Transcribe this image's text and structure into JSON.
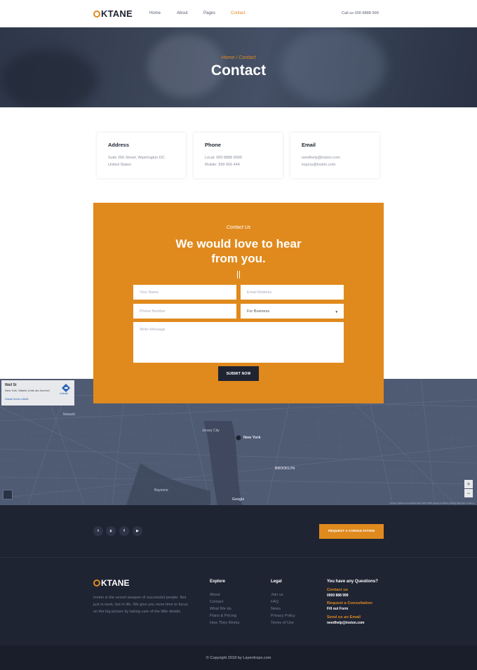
{
  "header": {
    "logo_text": "KTANE",
    "nav": [
      "Home",
      "About",
      "Pages",
      "Contact"
    ],
    "active_nav": "Contact",
    "call_us": "Call us 000 8888 999"
  },
  "hero": {
    "breadcrumb": "Home / Contact",
    "title": "Contact"
  },
  "info_cards": [
    {
      "title": "Address",
      "line1": "Suite 266 Street, Washington DC",
      "line2": "United States"
    },
    {
      "title": "Phone",
      "line1": "Local: 000 8888 9999",
      "line2": "Mobile: 999 666 444"
    },
    {
      "title": "Email",
      "line1": "needhelp@inston.com",
      "line2": "inquiry@inston.com"
    }
  ],
  "contact_form": {
    "eyebrow": "Contact Us",
    "title_line1": "We would love to hear",
    "title_line2": "from you.",
    "name_placeholder": "Your Name",
    "email_placeholder": "Email Address",
    "phone_placeholder": "Phone Number",
    "select_value": "For Business",
    "message_placeholder": "Write Message",
    "submit_label": "SUBMIT NOW"
  },
  "map": {
    "place_title": "Wall St",
    "place_subtitle": "New York, Statele Unite ale Americii",
    "view_link": "Afișați harta mărită",
    "directions_label": "Indicații",
    "google_label": "Google",
    "footer_note": "Comenzi rapide de la tastatură   Date hartă ©2018 Google   Condiții de utilizare   Raportați o eroare în hartă",
    "zoom_in": "+",
    "zoom_out": "−",
    "labels": [
      "Newark",
      "Jersey City",
      "New York",
      "BROOKLYN",
      "Bayonne"
    ]
  },
  "footer": {
    "social": [
      "t",
      "p",
      "f",
      "▶"
    ],
    "request_button": "REQUEST A CONSULTATION",
    "logo_text": "KTANE",
    "about": "Inston is the secret weapon of successful people. Not just in work, but in life. We give you more time to focus on the big picture by taking care of the little details.",
    "explore_title": "Explore",
    "explore_links": [
      "About",
      "Contact",
      "What We do",
      "Plans & Pricing",
      "How They Works"
    ],
    "legal_title": "Legal",
    "legal_links": [
      "Join us",
      "FAQ",
      "News",
      "Privacy Policy",
      "Terms of Use"
    ],
    "questions_title": "You have any Questions?",
    "contact_label": "Contact us",
    "contact_value": "0000 888 999",
    "consult_label": "Request a Consultation",
    "consult_value": "Fill out Form",
    "email_label": "Send us an Email",
    "email_value": "needhelp@inston.com",
    "copyright": "© Copyright 2018 by Layerdrops.com"
  },
  "colors": {
    "accent": "#e08a1e",
    "dark": "#1f2433",
    "map": "#4f5a73"
  }
}
